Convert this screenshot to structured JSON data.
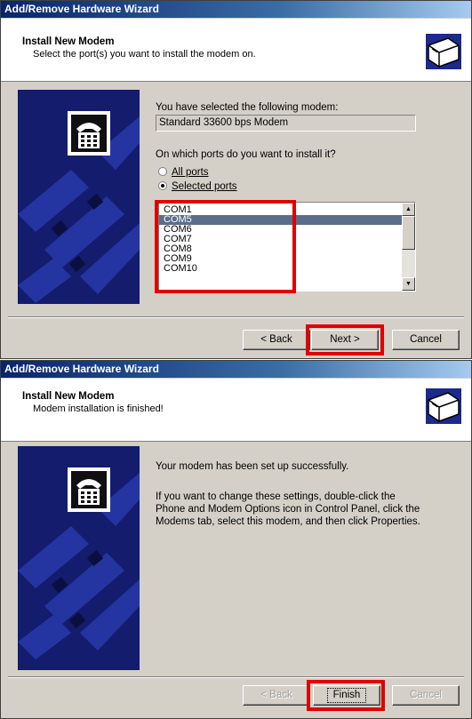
{
  "window1": {
    "title": "Add/Remove Hardware Wizard",
    "header_title": "Install New Modem",
    "header_subtitle": "Select the port(s) you want to install the modem on.",
    "selected_modem_label": "You have selected the following modem:",
    "selected_modem_value": "Standard 33600 bps Modem",
    "ports_question": "On which ports do you want to install it?",
    "radio_all_ports": "All ports",
    "radio_selected_ports": "Selected ports",
    "selected_radio": "Selected ports",
    "ports": [
      "COM1",
      "COM5",
      "COM6",
      "COM7",
      "COM8",
      "COM9",
      "COM10"
    ],
    "selected_port": "COM5",
    "back_label": "< Back",
    "next_label": "Next >",
    "cancel_label": "Cancel"
  },
  "window2": {
    "title": "Add/Remove Hardware Wizard",
    "header_title": "Install New Modem",
    "header_subtitle": "Modem installation is finished!",
    "message": "Your modem has been set up successfully.",
    "info_lines": [
      "If you want to change these settings, double-click the",
      "Phone and Modem Options icon in Control Panel, click the",
      "Modems tab, select this modem, and then click Properties."
    ],
    "back_label": "< Back",
    "finish_label": "Finish",
    "cancel_label": "Cancel"
  },
  "colors": {
    "highlight_box": "#e00000",
    "titlebar": "#0a246a",
    "panel": "#141c6e"
  }
}
